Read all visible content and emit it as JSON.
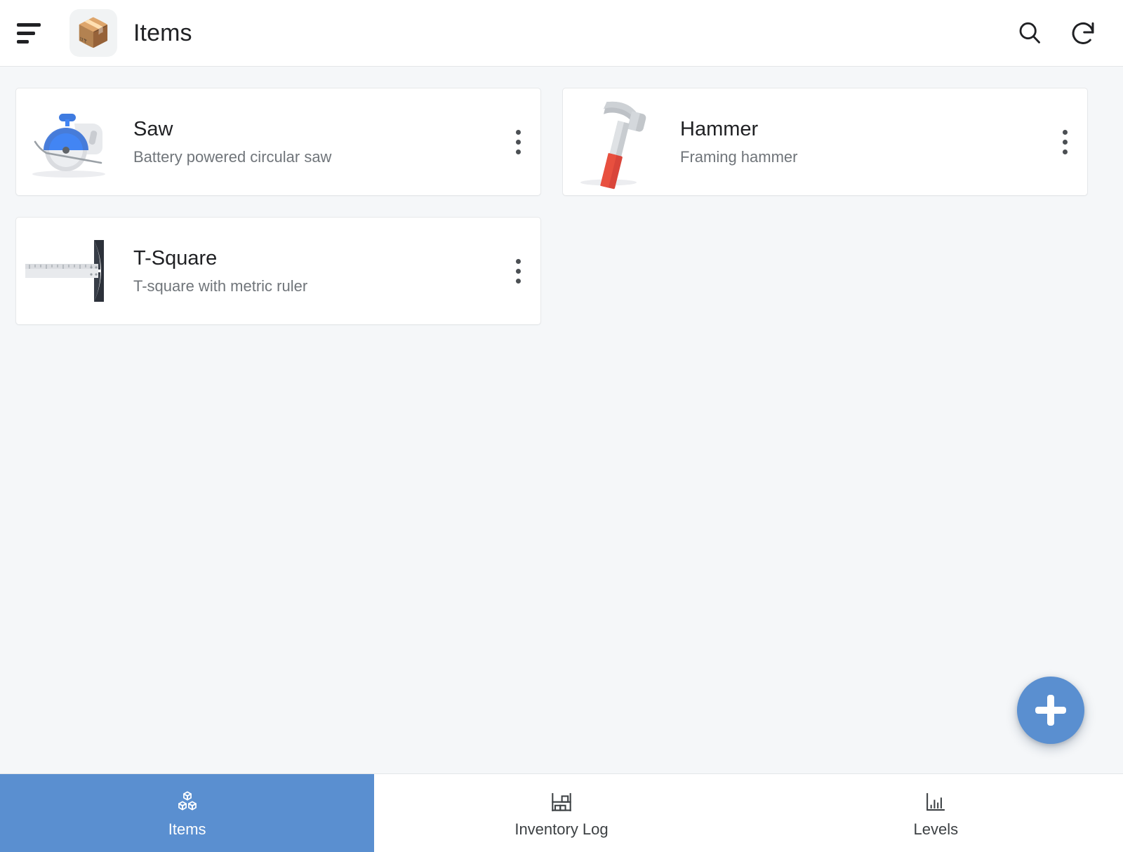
{
  "header": {
    "menu_icon": "short-menu-icon",
    "app_icon": "📦",
    "title": "Items",
    "actions": [
      {
        "name": "search-icon",
        "label": "Search"
      },
      {
        "name": "refresh-icon",
        "label": "Refresh"
      }
    ]
  },
  "items": [
    {
      "title": "Saw",
      "subtitle": "Battery powered circular saw",
      "thumb": "circular-saw-illustration",
      "menu": "more-options-icon"
    },
    {
      "title": "Hammer",
      "subtitle": "Framing hammer",
      "thumb": "hammer-illustration",
      "menu": "more-options-icon"
    },
    {
      "title": "T-Square",
      "subtitle": "T-square with metric ruler",
      "thumb": "t-square-illustration",
      "menu": "more-options-icon"
    }
  ],
  "fab": {
    "icon": "plus-icon",
    "label": "Add item"
  },
  "bottom_nav": {
    "active_index": 0,
    "tabs": [
      {
        "label": "Items",
        "icon": "cubes-icon"
      },
      {
        "label": "Inventory Log",
        "icon": "shelf-icon"
      },
      {
        "label": "Levels",
        "icon": "bar-chart-icon"
      }
    ]
  },
  "colors": {
    "accent": "#5a8fd0",
    "background": "#f5f7f9",
    "surface": "#ffffff",
    "text_primary": "#1f2023",
    "text_secondary": "#70757a"
  }
}
